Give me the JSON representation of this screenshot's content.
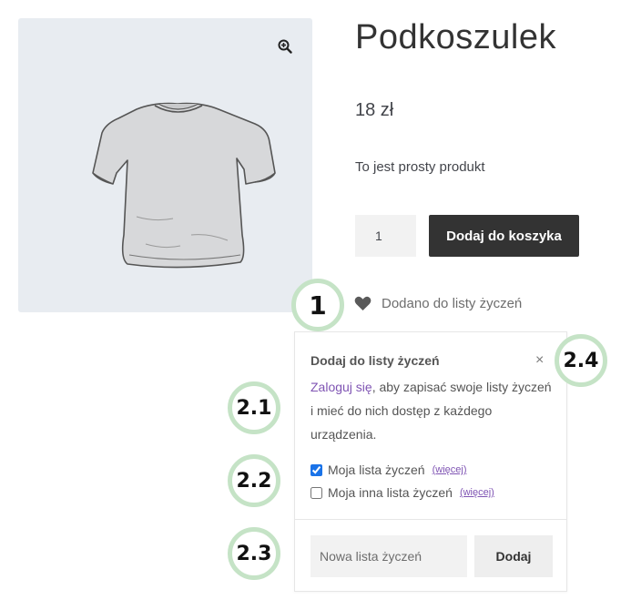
{
  "product": {
    "title": "Podkoszulek",
    "price": "18 zł",
    "description": "To jest prosty produkt",
    "quantity": "1",
    "add_to_cart_label": "Dodaj do koszyka",
    "image_icon": "tshirt-image",
    "zoom_icon": "magnifier-plus-icon"
  },
  "wishlist": {
    "status_icon": "heart-icon",
    "status_text": "Dodano do listy życzeń"
  },
  "popup": {
    "title": "Dodaj do listy życzeń",
    "close_symbol": "×",
    "login_link": "Zaloguj się",
    "message_rest": ", aby zapisać swoje listy życzeń i mieć do nich dostęp z każdego urządzenia.",
    "lists": [
      {
        "label": "Moja lista życzeń",
        "more": "(więcej)",
        "checked": true
      },
      {
        "label": "Moja inna lista życzeń",
        "more": "(więcej)",
        "checked": false
      }
    ],
    "new_list_placeholder": "Nowa lista życzeń",
    "add_button": "Dodaj"
  },
  "markers": {
    "m1": "1",
    "m21": "2.1",
    "m22": "2.2",
    "m23": "2.3",
    "m24": "2.4"
  },
  "colors": {
    "marker_ring": "#c5e3c6",
    "link": "#7f54b3",
    "button_dark": "#333333",
    "image_bg": "#e8ecf1"
  }
}
